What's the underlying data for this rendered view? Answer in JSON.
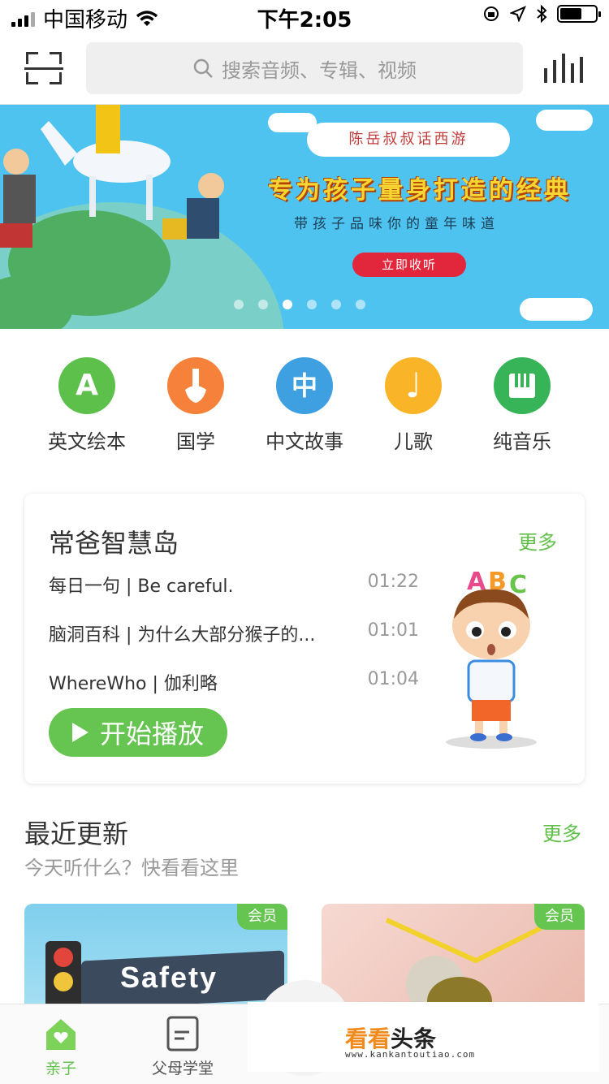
{
  "status_bar": {
    "carrier": "中国移动",
    "time": "下午2:05"
  },
  "search": {
    "placeholder": "搜索音频、专辑、视频"
  },
  "banner": {
    "cloud_text": "陈岳叔叔话西游",
    "headline": "专为孩子量身打造的经典",
    "subline": "带孩子品味你的童年味道",
    "button": "立即收听",
    "dot_count": 6,
    "active_dot": 2
  },
  "categories": [
    {
      "label": "英文绘本",
      "glyph": "A",
      "color": "#5cc04a",
      "icon": "letter-a-icon"
    },
    {
      "label": "国学",
      "glyph": "",
      "color": "#f5813a",
      "icon": "brush-icon"
    },
    {
      "label": "中文故事",
      "glyph": "中",
      "color": "#3ea0e0",
      "icon": "chinese-char-icon"
    },
    {
      "label": "儿歌",
      "glyph": "♩",
      "color": "#f9b428",
      "icon": "music-note-icon"
    },
    {
      "label": "纯音乐",
      "glyph": "",
      "color": "#36b457",
      "icon": "piano-icon"
    }
  ],
  "card": {
    "title": "常爸智慧岛",
    "more": "更多",
    "tracks": [
      {
        "name": "每日一句 | Be careful.",
        "duration": "01:22"
      },
      {
        "name": "脑洞百科 |  为什么大部分猴子的...",
        "duration": "01:01"
      },
      {
        "name": "WhereWho | 伽利略",
        "duration": "01:04"
      }
    ],
    "play_label": "开始播放"
  },
  "recent": {
    "title": "最近更新",
    "more": "更多",
    "subtitle": "今天听什么？快看看这里",
    "tiles": [
      {
        "badge": "会员",
        "text": "Safety"
      },
      {
        "badge": "会员",
        "text": ""
      }
    ]
  },
  "tabbar": {
    "tabs": [
      {
        "label": "亲子",
        "active": true
      },
      {
        "label": "父母学堂",
        "active": false
      }
    ],
    "active_color": "#61c04a"
  },
  "watermark": {
    "brand_a": "看看",
    "brand_b": "头条",
    "url": "www.kankantoutiao.com"
  }
}
